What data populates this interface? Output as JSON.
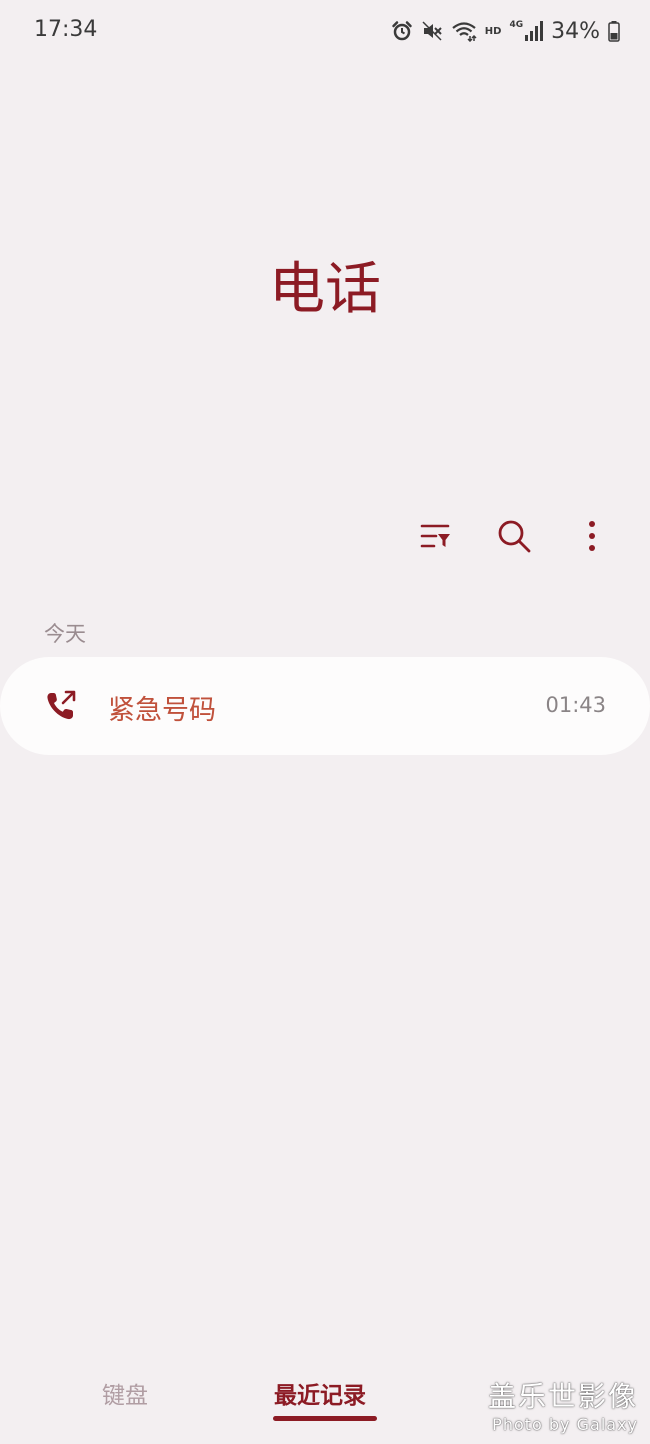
{
  "status_bar": {
    "time": "17:34",
    "network_hd": "HD",
    "network_type": "4G",
    "battery_percent": "34%"
  },
  "header": {
    "title": "电话"
  },
  "toolbar": {
    "icons": [
      "filter-icon",
      "search-icon",
      "more-options-icon"
    ]
  },
  "recents": {
    "section_label": "今天",
    "items": [
      {
        "name": "紧急号码",
        "time": "01:43",
        "icon": "outgoing-call-icon"
      }
    ]
  },
  "bottom_nav": {
    "tabs": [
      {
        "label": "键盘",
        "active": false
      },
      {
        "label": "最近记录",
        "active": true
      }
    ]
  },
  "watermark": {
    "title": "盖乐世影像",
    "subtitle": "Photo by Galaxy"
  },
  "colors": {
    "accent": "#8c1b24",
    "background": "#f3eff1",
    "call_name": "#c0513b"
  }
}
